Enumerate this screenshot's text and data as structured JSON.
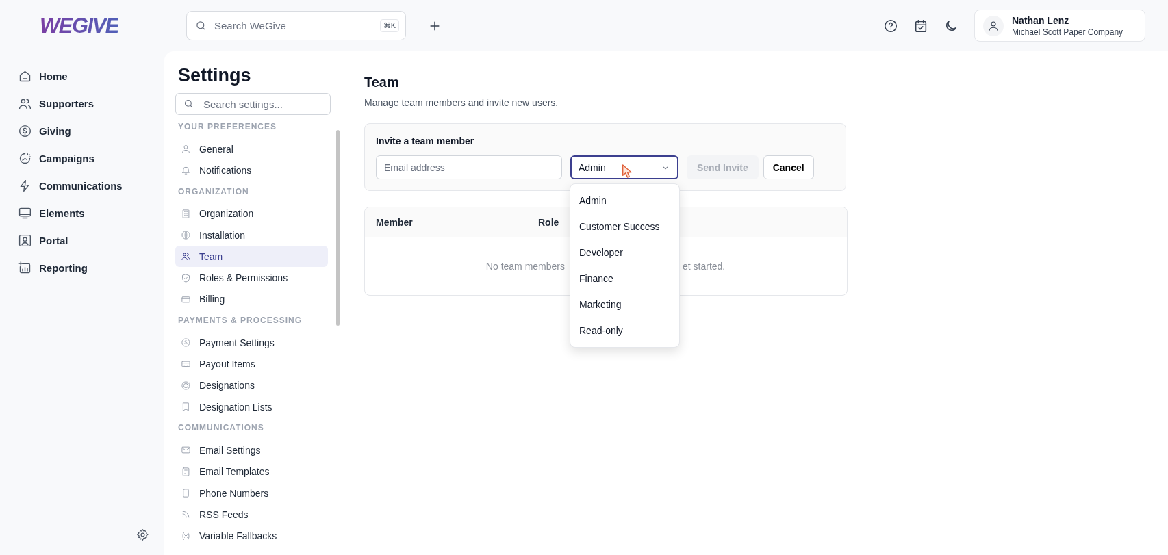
{
  "brand": {
    "logo": "WEGIVE"
  },
  "search": {
    "placeholder": "Search WeGive",
    "shortcut": "⌘K"
  },
  "user": {
    "name": "Nathan Lenz",
    "organization": "Michael Scott Paper Company"
  },
  "nav": [
    {
      "label": "Home"
    },
    {
      "label": "Supporters"
    },
    {
      "label": "Giving"
    },
    {
      "label": "Campaigns"
    },
    {
      "label": "Communications"
    },
    {
      "label": "Elements"
    },
    {
      "label": "Portal"
    },
    {
      "label": "Reporting"
    }
  ],
  "settings": {
    "title": "Settings",
    "search_placeholder": "Search settings...",
    "sections": [
      {
        "heading": "YOUR PREFERENCES",
        "items": [
          {
            "label": "General",
            "selected": false
          },
          {
            "label": "Notifications",
            "selected": false
          }
        ]
      },
      {
        "heading": "ORGANIZATION",
        "items": [
          {
            "label": "Organization",
            "selected": false
          },
          {
            "label": "Installation",
            "selected": false
          },
          {
            "label": "Team",
            "selected": true
          },
          {
            "label": "Roles & Permissions",
            "selected": false
          },
          {
            "label": "Billing",
            "selected": false
          }
        ]
      },
      {
        "heading": "PAYMENTS & PROCESSING",
        "items": [
          {
            "label": "Payment Settings",
            "selected": false
          },
          {
            "label": "Payout Items",
            "selected": false
          },
          {
            "label": "Designations",
            "selected": false
          },
          {
            "label": "Designation Lists",
            "selected": false
          }
        ]
      },
      {
        "heading": "COMMUNICATIONS",
        "items": [
          {
            "label": "Email Settings",
            "selected": false
          },
          {
            "label": "Email Templates",
            "selected": false
          },
          {
            "label": "Phone Numbers",
            "selected": false
          },
          {
            "label": "RSS Feeds",
            "selected": false
          },
          {
            "label": "Variable Fallbacks",
            "selected": false
          }
        ]
      }
    ]
  },
  "page": {
    "title": "Team",
    "subtitle": "Manage team members and invite new users.",
    "invite": {
      "title": "Invite a team member",
      "email_placeholder": "Email address",
      "role": "Admin",
      "send_label": "Send Invite",
      "send_disabled": true,
      "cancel_label": "Cancel"
    },
    "table": {
      "columns": [
        "Member",
        "Role"
      ],
      "empty_text_parts": [
        "No team members",
        "et started."
      ]
    },
    "role_menu": {
      "open": true,
      "options": [
        "Admin",
        "Customer Success",
        "Developer",
        "Finance",
        "Marketing",
        "Read-only"
      ]
    }
  }
}
